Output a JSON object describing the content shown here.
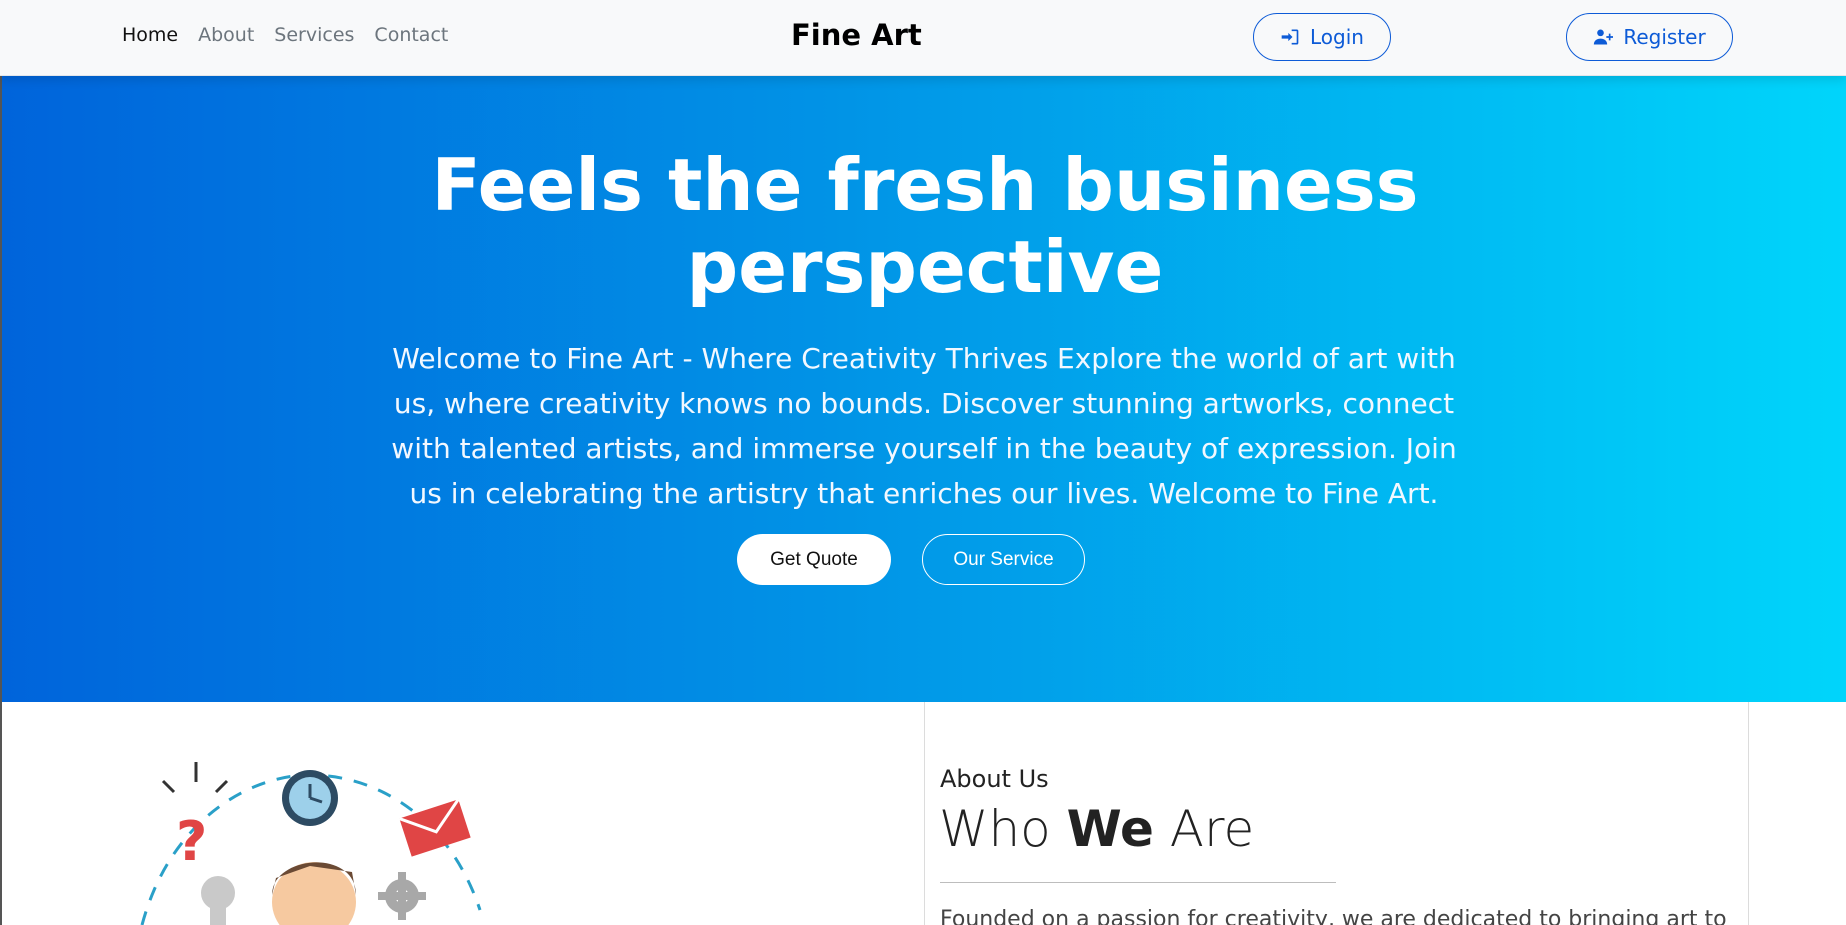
{
  "navbar": {
    "links": [
      "Home",
      "About",
      "Services",
      "Contact"
    ],
    "brand": "Fine Art",
    "login_label": "Login",
    "register_label": "Register"
  },
  "hero": {
    "title": "Feels the fresh business perspective",
    "text": "Welcome to Fine Art - Where Creativity Thrives Explore the world of art with us, where creativity knows no bounds. Discover stunning artworks, connect with talented artists, and immerse yourself in the beauty of expression. Join us in celebrating the artistry that enriches our lives. Welcome to Fine Art.",
    "quote_button": "Get Quote",
    "service_button": "Our Service"
  },
  "about": {
    "subtitle": "About Us",
    "title_prefix": "Who ",
    "title_emphasis": "We",
    "title_suffix": " Are",
    "text": "Founded on a passion for creativity, we are dedicated to bringing art to life"
  },
  "colors": {
    "brand_blue": "#0d5bd7",
    "hero_gradient_start": "#0064db",
    "hero_gradient_end": "#00d5fb"
  },
  "icons": {
    "login": "sign-in-icon",
    "register": "user-plus-icon"
  }
}
